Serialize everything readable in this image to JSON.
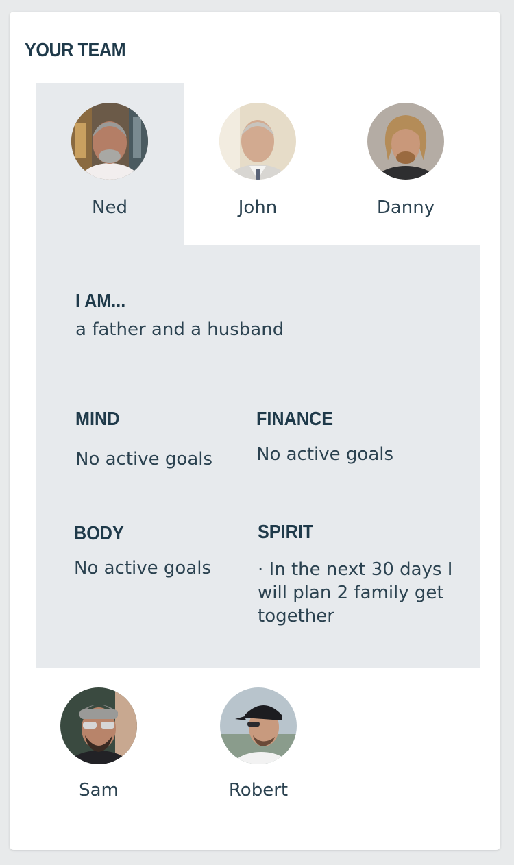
{
  "title": "YOUR TEAM",
  "team": {
    "members": [
      {
        "name": "Ned",
        "selected": true
      },
      {
        "name": "John",
        "selected": false
      },
      {
        "name": "Danny",
        "selected": false
      },
      {
        "name": "Sam",
        "selected": false
      },
      {
        "name": "Robert",
        "selected": false
      }
    ]
  },
  "detail": {
    "iam_heading": "I AM...",
    "iam_text": "a father and a husband",
    "mind": {
      "heading": "MIND",
      "text": "No active goals"
    },
    "finance": {
      "heading": "FINANCE",
      "text": "No active goals"
    },
    "body": {
      "heading": "BODY",
      "text": "No active goals"
    },
    "spirit": {
      "heading": "SPIRIT",
      "goals": [
        "In the next 30 days I will plan 2 family get together"
      ]
    }
  },
  "colors": {
    "background": "#e8eaeb",
    "card": "#ffffff",
    "selected_panel": "#e7eaed",
    "heading": "#1f3a4a",
    "text": "#2b4250"
  }
}
